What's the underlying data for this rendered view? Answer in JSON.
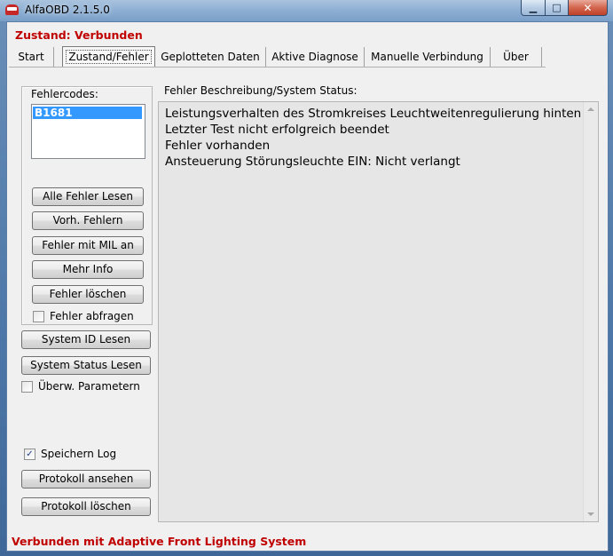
{
  "window": {
    "title": "AlfaOBD 2.1.5.0",
    "minimize_glyph": "▁",
    "maximize_glyph": "□",
    "close_glyph": "✕"
  },
  "status_top": "Zustand: Verbunden",
  "tabs": [
    {
      "label": "Start"
    },
    {
      "label": "Zustand/Fehler"
    },
    {
      "label": "Geplotteten Daten"
    },
    {
      "label": "Aktive Diagnose"
    },
    {
      "label": "Manuelle Verbindung"
    },
    {
      "label": "Über"
    }
  ],
  "fault_codes": {
    "label": "Fehlercodes:",
    "items": [
      "B1681"
    ]
  },
  "buttons": {
    "read_all": "Alle Fehler Lesen",
    "prev": "Vorh. Fehlern",
    "mil": "Fehler mit MIL an",
    "more_info": "Mehr Info",
    "delete": "Fehler löschen",
    "system_id": "System ID Lesen",
    "system_status": "System Status Lesen",
    "view_log": "Protokoll ansehen",
    "delete_log": "Protokoll löschen"
  },
  "checkboxes": {
    "poll_faults": {
      "label": "Fehler abfragen",
      "checked": false
    },
    "monitor_params": {
      "label": "Überw. Parametern",
      "checked": false
    },
    "save_log": {
      "label": "Speichern Log",
      "checked": true,
      "mark": "✓"
    }
  },
  "description": {
    "label": "Fehler Beschreibung/System Status:",
    "lines": [
      "Leistungsverhalten des Stromkreises Leuchtweitenregulierung hinten",
      "Letzter Test nicht erfolgreich beendet",
      "Fehler vorhanden",
      "Ansteuerung Störungsleuchte EIN: Nicht verlangt"
    ]
  },
  "status_bottom": "Verbunden mit Adaptive Front Lighting System",
  "colors": {
    "status_red": "#c00000",
    "selection_blue": "#3399ff"
  }
}
